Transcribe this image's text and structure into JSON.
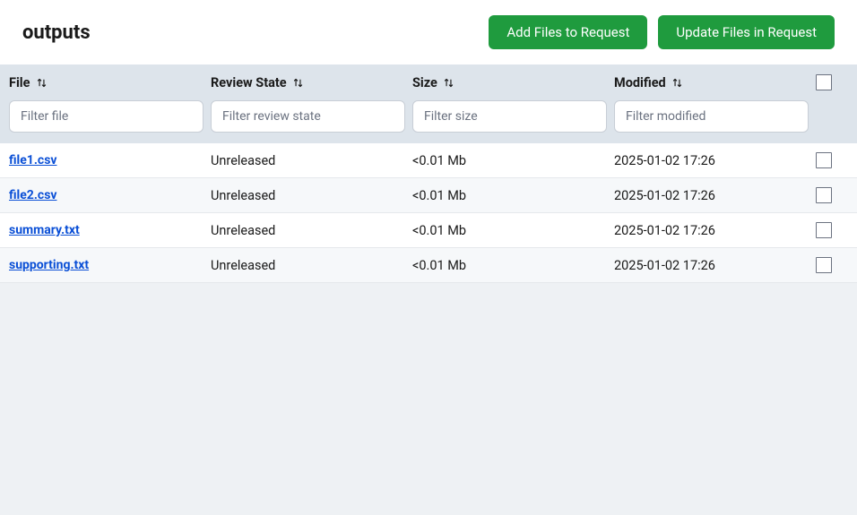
{
  "header": {
    "title": "outputs",
    "add_button": "Add Files to Request",
    "update_button": "Update Files in Request"
  },
  "columns": {
    "file": {
      "label": "File",
      "placeholder": "Filter file"
    },
    "review": {
      "label": "Review State",
      "placeholder": "Filter review state"
    },
    "size": {
      "label": "Size",
      "placeholder": "Filter size"
    },
    "modified": {
      "label": "Modified",
      "placeholder": "Filter modified"
    }
  },
  "rows": [
    {
      "file": "file1.csv",
      "review": "Unreleased",
      "size": "<0.01 Mb",
      "modified": "2025-01-02 17:26"
    },
    {
      "file": "file2.csv",
      "review": "Unreleased",
      "size": "<0.01 Mb",
      "modified": "2025-01-02 17:26"
    },
    {
      "file": "summary.txt",
      "review": "Unreleased",
      "size": "<0.01 Mb",
      "modified": "2025-01-02 17:26"
    },
    {
      "file": "supporting.txt",
      "review": "Unreleased",
      "size": "<0.01 Mb",
      "modified": "2025-01-02 17:26"
    }
  ]
}
